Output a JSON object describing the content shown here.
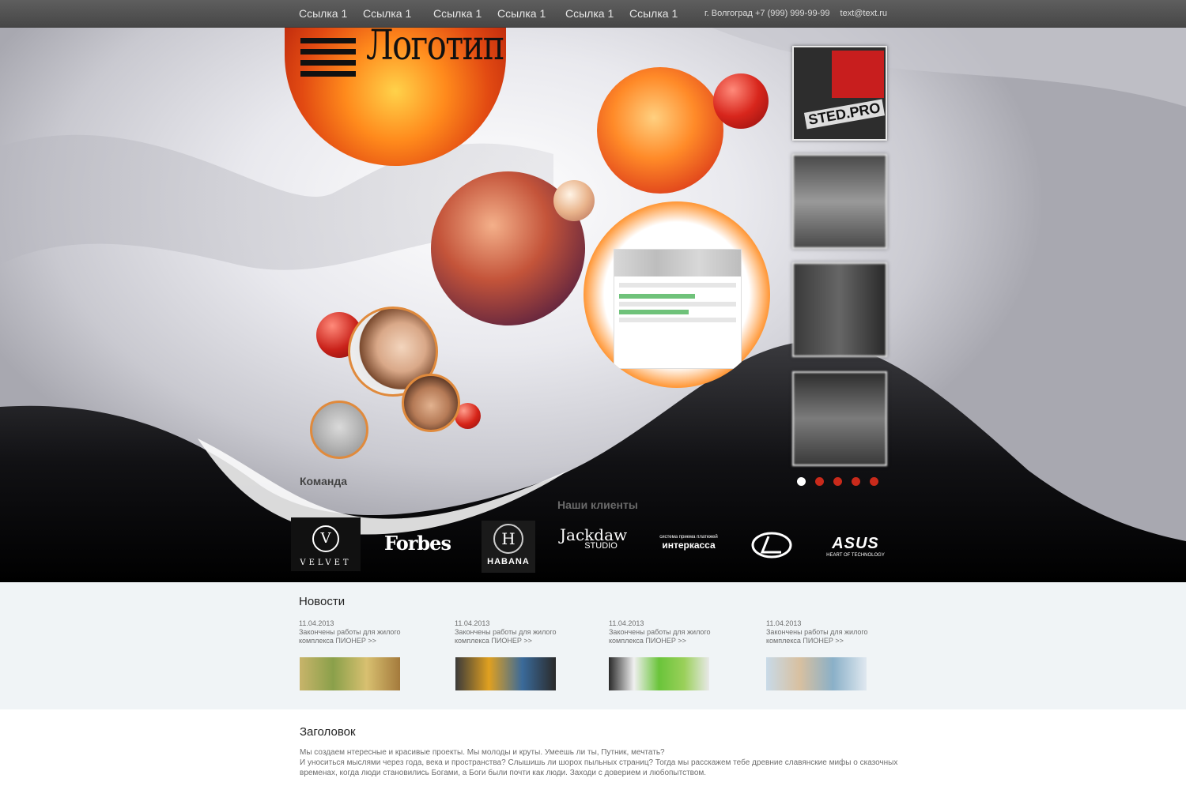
{
  "nav": {
    "links": [
      "Ссылка 1",
      "Ссылка 1",
      "Ссылка 1",
      "Ссылка 1",
      "Ссылка 1",
      "Ссылка 1"
    ],
    "city_phone": "г. Волгоград +7 (999) 999-99-99",
    "email": "text@text.ru"
  },
  "hero": {
    "logo_text": "Логотип",
    "team_label": "Команда",
    "clients_title": "Наши клиенты",
    "slider_total": 5,
    "slider_active": 1,
    "thumb_brand": "STED.PRO",
    "accent_color": "#c92a1b"
  },
  "clients": [
    {
      "name": "VELVET",
      "mark": "V"
    },
    {
      "name": "Forbes"
    },
    {
      "name": "HABANA",
      "mark": "H"
    },
    {
      "name": "Jackdaw",
      "sub": "STUDIO"
    },
    {
      "name": "интеркасса",
      "sub": "система приема платежей"
    },
    {
      "name": "Lexus"
    },
    {
      "name": "ASUS",
      "sub": "HEART OF TECHNOLOGY"
    }
  ],
  "news": {
    "title": "Новости",
    "items": [
      {
        "date": "11.04.2013",
        "text": "Закончены работы для жилого комплекса ПИОНЕР  >>"
      },
      {
        "date": "11.04.2013",
        "text": "Закончены работы для жилого комплекса ПИОНЕР  >>"
      },
      {
        "date": "11.04.2013",
        "text": "Закончены работы для жилого комплекса ПИОНЕР  >>"
      },
      {
        "date": "11.04.2013",
        "text": "Закончены работы для жилого комплекса ПИОНЕР  >>"
      }
    ]
  },
  "article": {
    "title": "Заголовок",
    "line1": "Мы создаем нтересные и красивые проекты. Мы молоды и круты. Умеешь ли ты, Путник, мечтать?",
    "line2": "И уноситься мыслями через года, века и пространства? Слышишь ли шорох пыльных страниц? Тогда мы расскажем тебе древние славянские мифы о сказочных временах, когда люди становились Богами, а Боги были почти как люди. Заходи с доверием и любопытством."
  }
}
